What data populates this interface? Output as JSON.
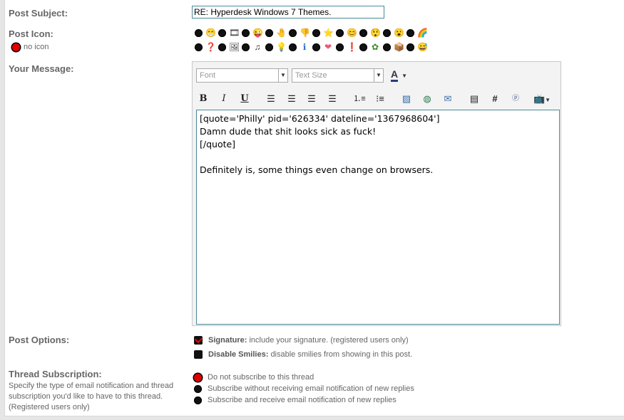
{
  "labels": {
    "post_subject": "Post Subject:",
    "post_icon": "Post Icon:",
    "no_icon": "no icon",
    "your_message": "Your Message:",
    "post_options": "Post Options:",
    "thread_subscription": "Thread Subscription:",
    "thread_sub_desc": "Specify the type of email notification and thread subscription you'd like to have to this thread. (Registered users only)"
  },
  "subject": {
    "value": "RE: Hyperdesk Windows 7 Themes."
  },
  "icons_row1": [
    "😁",
    "🎞",
    "😜",
    "🤚",
    "👎",
    "⭐",
    "😊",
    "😲",
    "😮",
    "🌈"
  ],
  "icons_row2": [
    "❓",
    "🖼",
    "♫",
    "💡",
    "ℹ",
    "❤",
    "❗",
    "✿",
    "📦",
    "😅"
  ],
  "editor": {
    "font_placeholder": "Font",
    "size_placeholder": "Text Size",
    "message": "[quote='Philly' pid='626334' dateline='1367968604']\nDamn dude that shit looks sick as fuck!\n[/quote]\n\nDefinitely is, some things even change on browsers."
  },
  "options": {
    "signature_label": "Signature:",
    "signature_desc": "include your signature. (registered users only)",
    "smilies_label": "Disable Smilies:",
    "smilies_desc": "disable smilies from showing in this post."
  },
  "subscription": {
    "opt1": "Do not subscribe to this thread",
    "opt2": "Subscribe without receiving email notification of new replies",
    "opt3": "Subscribe and receive email notification of new replies"
  }
}
